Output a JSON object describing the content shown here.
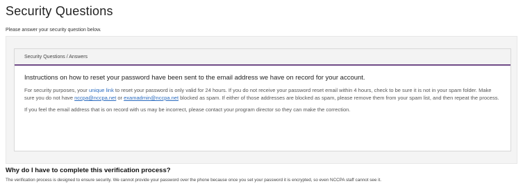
{
  "page": {
    "title": "Security Questions",
    "subtitle": "Please answer your security question below."
  },
  "card": {
    "header": "Security Questions / Answers",
    "lead": "Instructions on how to reset your password have been sent to the email address we have on record for your account.",
    "para1_a": "For security purposes, your ",
    "para1_highlight": "unique link",
    "para1_b": " to reset your password is only valid for 24 hours. If you do not receive your password reset email within 4 hours, check to be sure it is not in your spam folder. Make sure you do not have ",
    "email1": "nccpa@nccpa.net",
    "para1_c": " or ",
    "email2": "examadmin@nccpa.net",
    "para1_d": " blocked as spam. If either of those addresses are blocked as spam, please remove them from your spam list, and then repeat the process.",
    "para2": "If you feel the email address that is on record with us may be incorrect, please contact your program director so they can make the correction."
  },
  "why": {
    "title": "Why do I have to complete this verification process?",
    "text": "The verification process is designed to ensure security. We cannot provide your password over the phone because once you set your password it is encrypted, so even NCCPA staff cannot see it."
  },
  "colors": {
    "accent": "#6f4a86",
    "link": "#2a6bbf"
  }
}
